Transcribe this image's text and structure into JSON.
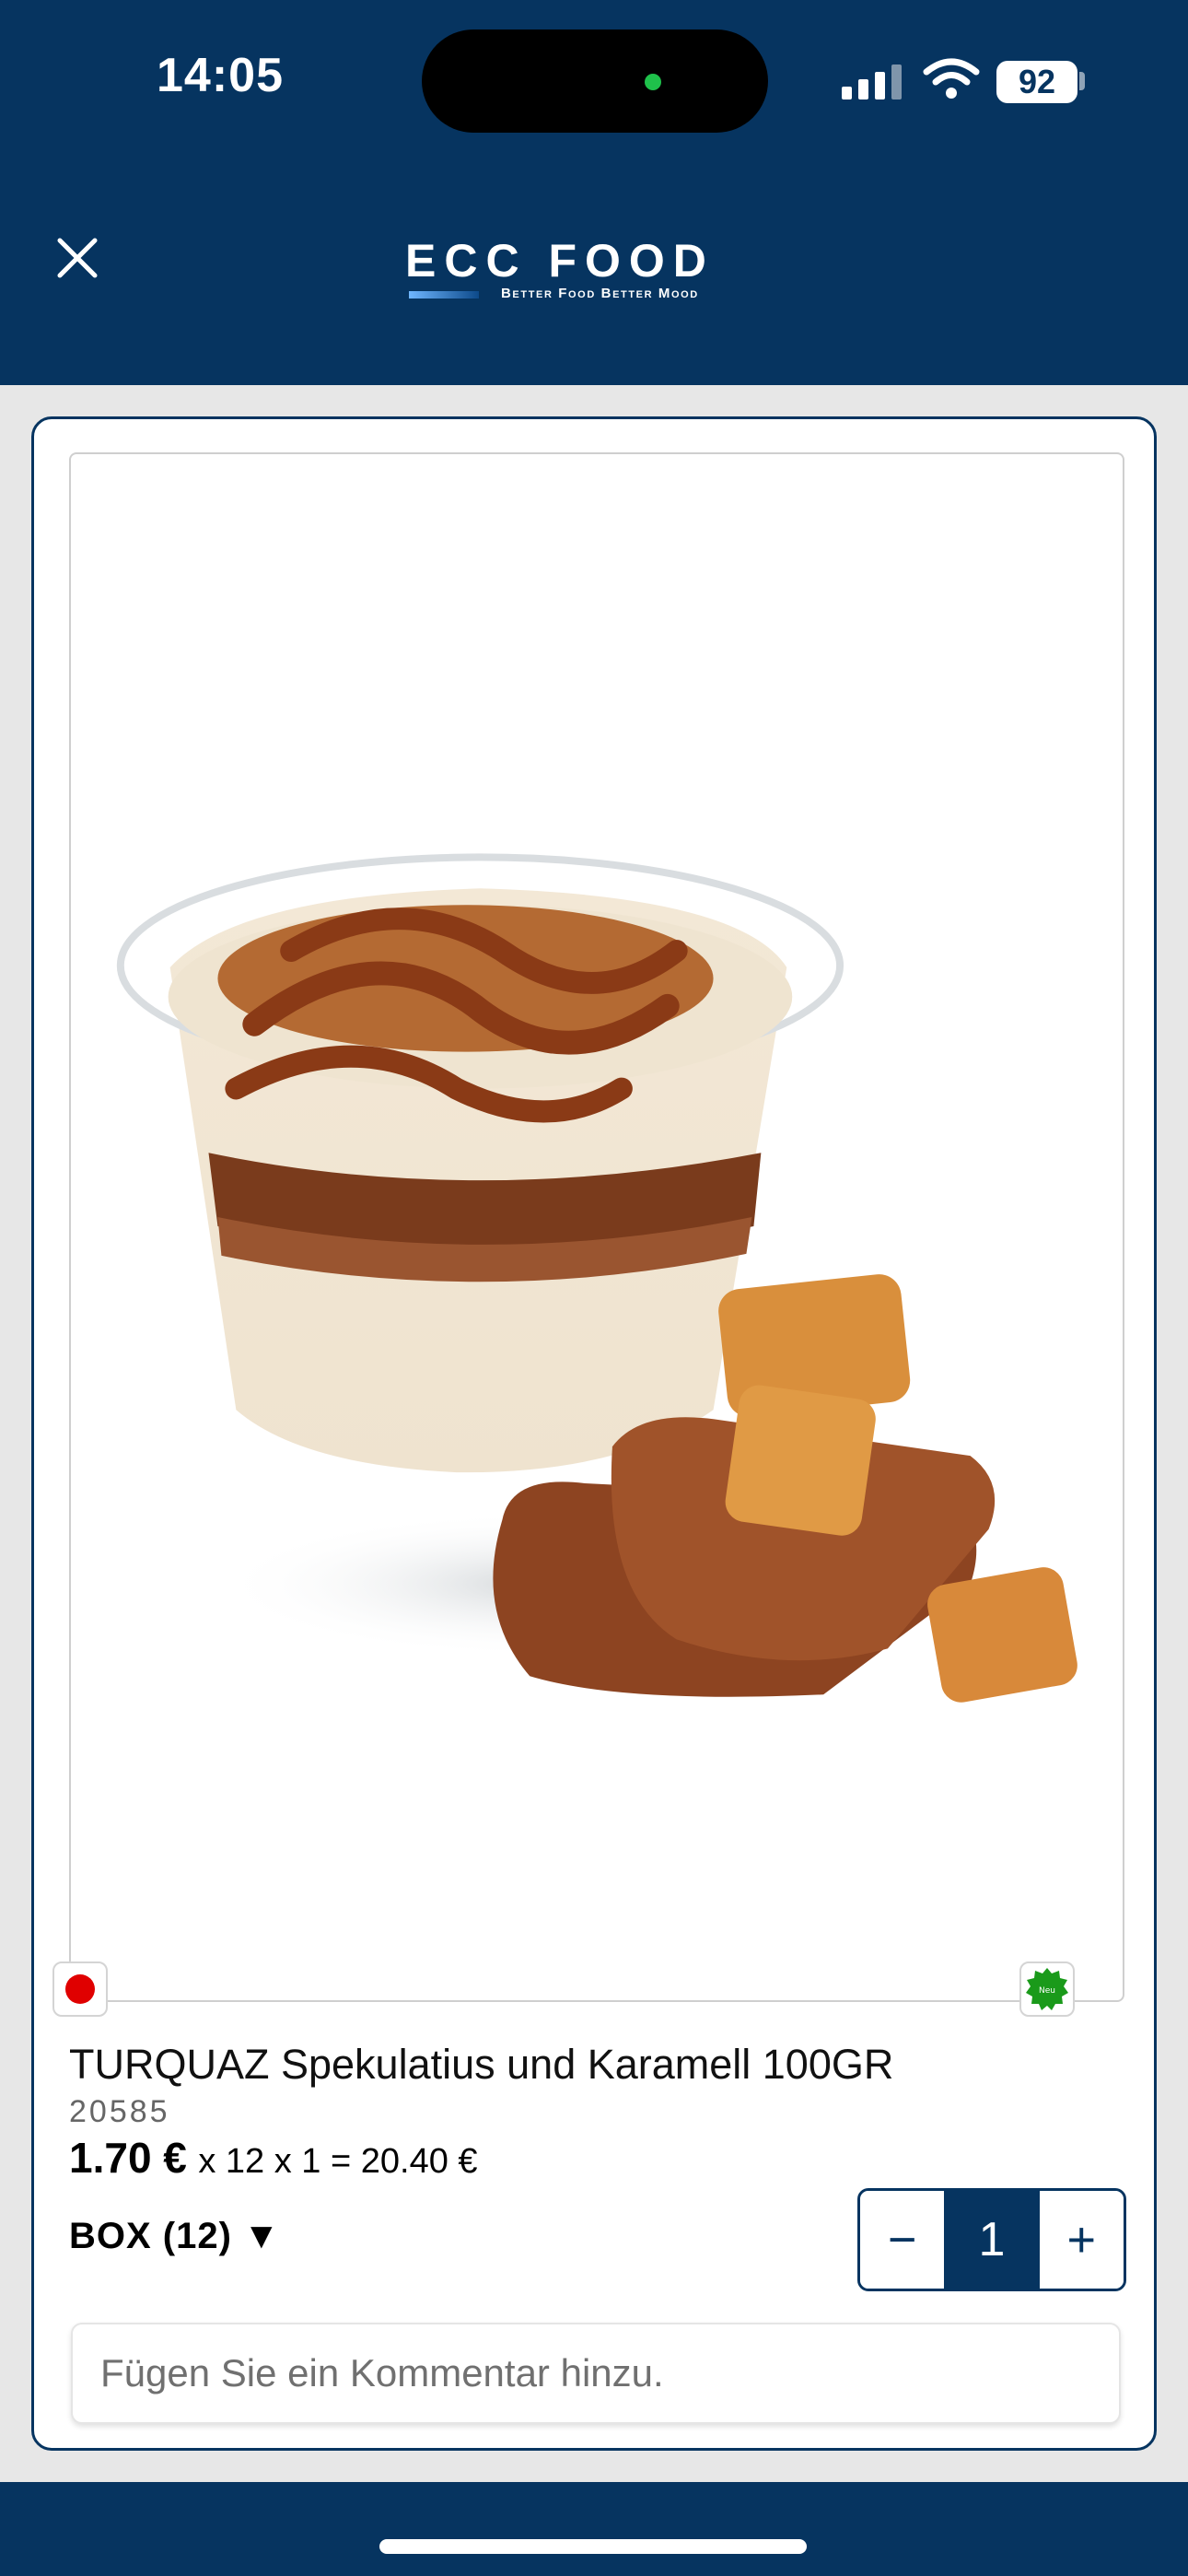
{
  "status_bar": {
    "time": "14:05",
    "battery": "92"
  },
  "header": {
    "close_icon": "close-icon",
    "logo_title": "ECC FOOD",
    "logo_tagline": "Better Food Better Mood"
  },
  "product": {
    "name": "TURQUAZ Spekulatius und Karamell 100GR",
    "sku": "20585",
    "price": "1.70 €",
    "price_calc": "x 12 x 1 = 20.40 €",
    "unit": "BOX (12) ▼",
    "badge_new": "Neu",
    "quantity": "1",
    "decrement_label": "−",
    "increment_label": "+",
    "comment_placeholder": "Fügen Sie ein Kommentar hinzu."
  },
  "colors": {
    "brand": "#063460",
    "status_red": "#e00000",
    "new_badge": "#1a9a1a"
  }
}
